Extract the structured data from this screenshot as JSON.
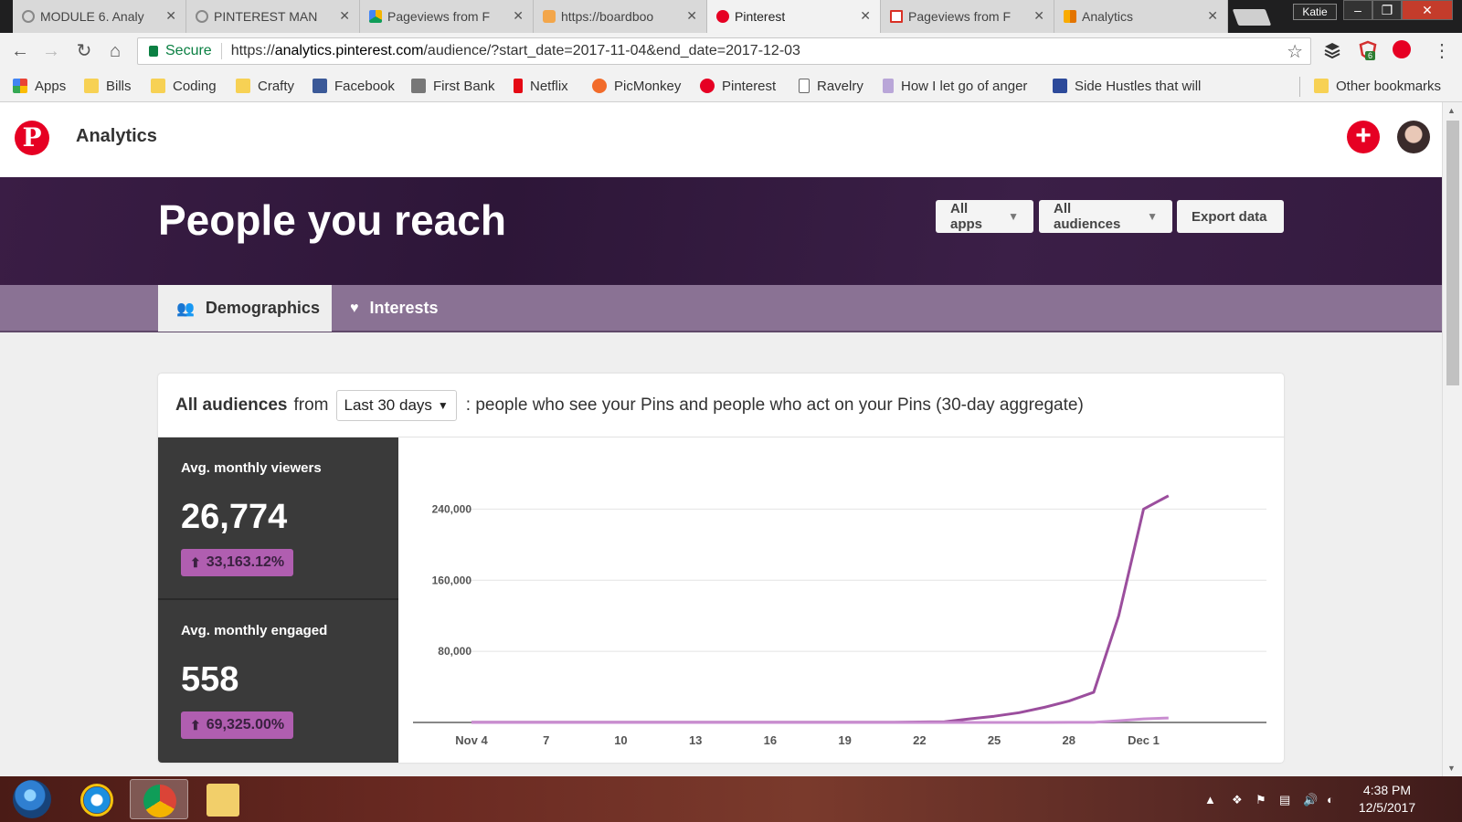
{
  "browser": {
    "tabs": [
      {
        "label": "MODULE 6. Analy",
        "icon": "globe-icon",
        "active": false
      },
      {
        "label": "PINTEREST MAN",
        "icon": "globe-icon",
        "active": false
      },
      {
        "label": "Pageviews from F",
        "icon": "google-drive-icon",
        "active": false
      },
      {
        "label": "https://boardboo",
        "icon": "butterfly-icon",
        "active": false
      },
      {
        "label": "Pinterest",
        "icon": "pinterest-icon",
        "active": true
      },
      {
        "label": "Pageviews from F",
        "icon": "gmail-icon",
        "active": false
      },
      {
        "label": "Analytics",
        "icon": "google-analytics-icon",
        "active": false
      }
    ],
    "user": "Katie",
    "secure_label": "Secure",
    "url_prefix": "https://",
    "url_host": "analytics.pinterest.com",
    "url_path": "/audience/?start_date=2017-11-04&end_date=2017-12-03",
    "extension_badge": "6",
    "bookmarks": [
      {
        "label": "Apps",
        "icon": "apps-grid-icon"
      },
      {
        "label": "Bills",
        "icon": "folder-icon"
      },
      {
        "label": "Coding",
        "icon": "folder-icon"
      },
      {
        "label": "Crafty",
        "icon": "folder-icon"
      },
      {
        "label": "Facebook",
        "icon": "facebook-icon"
      },
      {
        "label": "First Bank",
        "icon": "bank-icon"
      },
      {
        "label": "Netflix",
        "icon": "netflix-icon"
      },
      {
        "label": "PicMonkey",
        "icon": "picmonkey-icon"
      },
      {
        "label": "Pinterest",
        "icon": "pinterest-icon"
      },
      {
        "label": "Ravelry",
        "icon": "page-icon"
      },
      {
        "label": "How I let go of anger",
        "icon": "m-icon"
      },
      {
        "label": "Side Hustles that will",
        "icon": "grid-icon"
      }
    ],
    "other_bookmarks": "Other bookmarks"
  },
  "header": {
    "logo": "P",
    "title": "Analytics",
    "add_label": "+"
  },
  "banner": {
    "heading": "People you reach",
    "apps_filter": "All apps",
    "audience_filter": "All audiences",
    "export_label": "Export data"
  },
  "tabs": [
    {
      "label": "Demographics",
      "icon": "people-icon",
      "active": true
    },
    {
      "label": "Interests",
      "icon": "heart-icon",
      "active": false
    }
  ],
  "card": {
    "audience_label": "All audiences",
    "from_text": "from",
    "range_value": "Last 30 days",
    "description": ": people who see your Pins and people who act on your Pins (30-day aggregate)"
  },
  "stats": [
    {
      "label": "Avg. monthly viewers",
      "value": "26,774",
      "change": "33,163.12%",
      "direction": "up"
    },
    {
      "label": "Avg. monthly engaged",
      "value": "558",
      "change": "69,325.00%",
      "direction": "up"
    }
  ],
  "chart_data": {
    "type": "line",
    "x_labels": [
      "Nov 4",
      "7",
      "10",
      "13",
      "16",
      "19",
      "22",
      "25",
      "28",
      "Dec 1"
    ],
    "y_ticks": [
      "80,000",
      "160,000",
      "240,000"
    ],
    "ylim": [
      0,
      300000
    ],
    "grid": true,
    "series": [
      {
        "color": "#9b4e9d",
        "values": [
          300,
          300,
          300,
          300,
          300,
          300,
          300,
          300,
          300,
          300,
          300,
          300,
          300,
          300,
          300,
          300,
          300,
          300,
          500,
          800,
          4000,
          7000,
          11000,
          17000,
          24000,
          34000,
          120000,
          240000,
          255000
        ]
      },
      {
        "color": "#c98dd0",
        "values": [
          10,
          10,
          10,
          10,
          10,
          10,
          10,
          10,
          10,
          10,
          10,
          10,
          10,
          10,
          10,
          10,
          10,
          10,
          10,
          10,
          10,
          10,
          20,
          40,
          80,
          150,
          2000,
          4000,
          5000
        ]
      }
    ]
  },
  "taskbar": {
    "time": "4:38 PM",
    "date": "12/5/2017"
  }
}
